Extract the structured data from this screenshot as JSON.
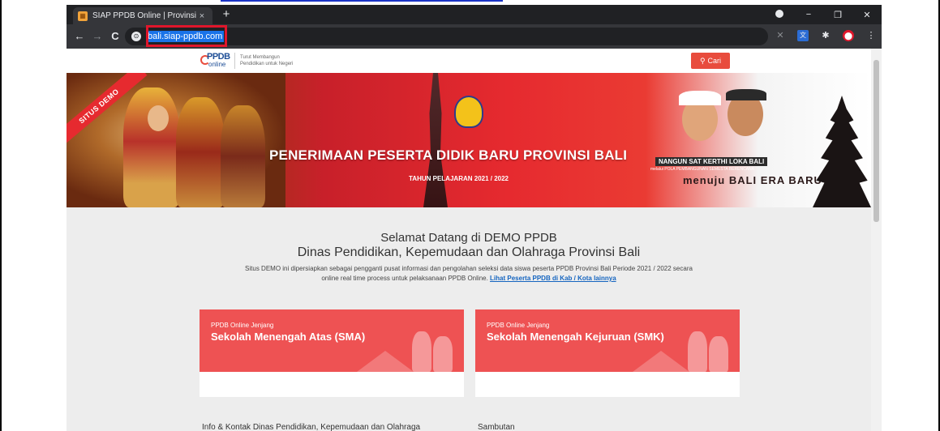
{
  "browser": {
    "tab_title": "SIAP PPDB Online | Provinsi Bali",
    "tab_close": "×",
    "new_tab": "+",
    "url": "bali.siap-ppdb.com",
    "back": "←",
    "forward": "→",
    "reload": "C",
    "minimize": "−",
    "restore": "❐",
    "close": "✕",
    "highlight_color": "#e0162b"
  },
  "header": {
    "logo_ppdb": "PPDB",
    "logo_online": "online",
    "tagline_line1": "Turut Membangun",
    "tagline_line2": "Pendidikan untuk Negeri",
    "search_label": "Cari",
    "accent": "#e84c3d"
  },
  "hero": {
    "ribbon": "SITUS DEMO",
    "title": "PENERIMAAN PESERTA DIDIK BARU PROVINSI BALI",
    "subtitle": "TAHUN PELAJARAN 2021 / 2022",
    "slogan_main": "NANGUN SAT KERTHI LOKA BALI",
    "slogan_small": "melalui POLA PEMBANGUNAN SEMESTA BERENCANA",
    "slogan_era": "menuju BALI ERA BARU"
  },
  "welcome": {
    "line1": "Selamat Datang di DEMO PPDB",
    "line2": "Dinas Pendidikan, Kepemudaan dan Olahraga Provinsi Bali",
    "desc1": "Situs DEMO ini dipersiapkan sebagai pengganti pusat informasi dan pengolahan seleksi data siswa peserta PPDB Provinsi Bali Periode 2021 / 2022 secara",
    "desc2": "online real time process untuk pelaksanaan PPDB Online.",
    "link": "Lihat Peserta PPDB di Kab / Kota lainnya"
  },
  "cards": [
    {
      "kicker": "PPDB Online Jenjang",
      "title": "Sekolah Menengah Atas (SMA)"
    },
    {
      "kicker": "PPDB Online Jenjang",
      "title": "Sekolah Menengah Kejuruan (SMK)"
    }
  ],
  "footer": {
    "info": "Info & Kontak Dinas Pendidikan, Kepemudaan dan Olahraga",
    "sambutan": "Sambutan"
  }
}
